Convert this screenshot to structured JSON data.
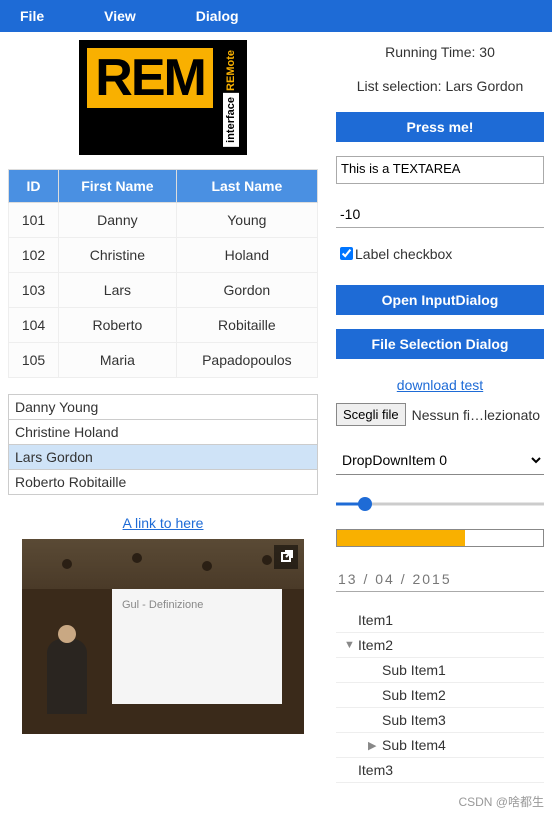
{
  "menu": {
    "file": "File",
    "view": "View",
    "dialog": "Dialog"
  },
  "status": {
    "running_time_label": "Running Time:",
    "running_time": "30",
    "selection_label": "List selection:",
    "selection_value": "Lars Gordon"
  },
  "buttons": {
    "press_me": "Press me!",
    "open_input": "Open InputDialog",
    "file_sel": "File Selection Dialog",
    "choose_file": "Scegli file"
  },
  "textarea": {
    "value": "This is a TEXTAREA"
  },
  "number_input": {
    "value": "-10"
  },
  "checkbox": {
    "label": "Label checkbox",
    "checked": true
  },
  "download_link": "download test",
  "file_chosen": "Nessun fi…lezionato",
  "dropdown": {
    "selected": "DropDownItem 0"
  },
  "slider": {
    "percent": 14
  },
  "progress": {
    "percent": 62
  },
  "date": {
    "value": "13 / 04 / 2015"
  },
  "tree": [
    {
      "label": "Item1",
      "indent": 0,
      "arrow": ""
    },
    {
      "label": "Item2",
      "indent": 0,
      "arrow": "▼"
    },
    {
      "label": "Sub Item1",
      "indent": 1,
      "arrow": ""
    },
    {
      "label": "Sub Item2",
      "indent": 1,
      "arrow": ""
    },
    {
      "label": "Sub Item3",
      "indent": 1,
      "arrow": ""
    },
    {
      "label": "Sub Item4",
      "indent": 1,
      "arrow": "▶"
    },
    {
      "label": "Item3",
      "indent": 0,
      "arrow": ""
    }
  ],
  "table": {
    "headers": {
      "id": "ID",
      "first": "First Name",
      "last": "Last Name"
    },
    "rows": [
      {
        "id": "101",
        "first": "Danny",
        "last": "Young"
      },
      {
        "id": "102",
        "first": "Christine",
        "last": "Holand"
      },
      {
        "id": "103",
        "first": "Lars",
        "last": "Gordon"
      },
      {
        "id": "104",
        "first": "Roberto",
        "last": "Robitaille"
      },
      {
        "id": "105",
        "first": "Maria",
        "last": "Papadopoulos"
      }
    ]
  },
  "list": {
    "items": [
      "Danny Young",
      "Christine Holand",
      "Lars Gordon",
      "Roberto Robitaille"
    ],
    "selected_index": 2
  },
  "link_here": "A link to here",
  "video_slide_title": "Gul - Definizione",
  "watermark": "CSDN @啥都生"
}
